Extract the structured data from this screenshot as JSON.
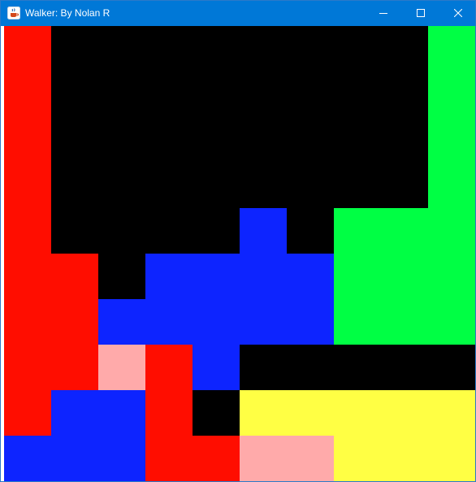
{
  "window": {
    "title": "Walker: By Nolan R",
    "accent_color": "#0078d7",
    "icons": {
      "app": "java-cup-icon",
      "minimize": "minimize-icon",
      "maximize": "maximize-icon",
      "close": "close-icon"
    }
  },
  "board": {
    "columns": 10,
    "rows": 10,
    "palette": {
      "K": "#000000",
      "R": "#ff0d00",
      "G": "#00ff44",
      "B": "#0d24ff",
      "P": "#ffaaaa",
      "Y": "#ffff44"
    },
    "cells": [
      "RKKKKKKKKG",
      "RKKKKKKKKG",
      "RKKKKKKKKG",
      "RKKKKKKKKG",
      "RKKKKBKGGG",
      "RRKBBBBGGG",
      "RRBBBBBGGG",
      "RRPRBKKKKK",
      "RBBRKYYYYY",
      "BBBRRPPYYY"
    ]
  }
}
